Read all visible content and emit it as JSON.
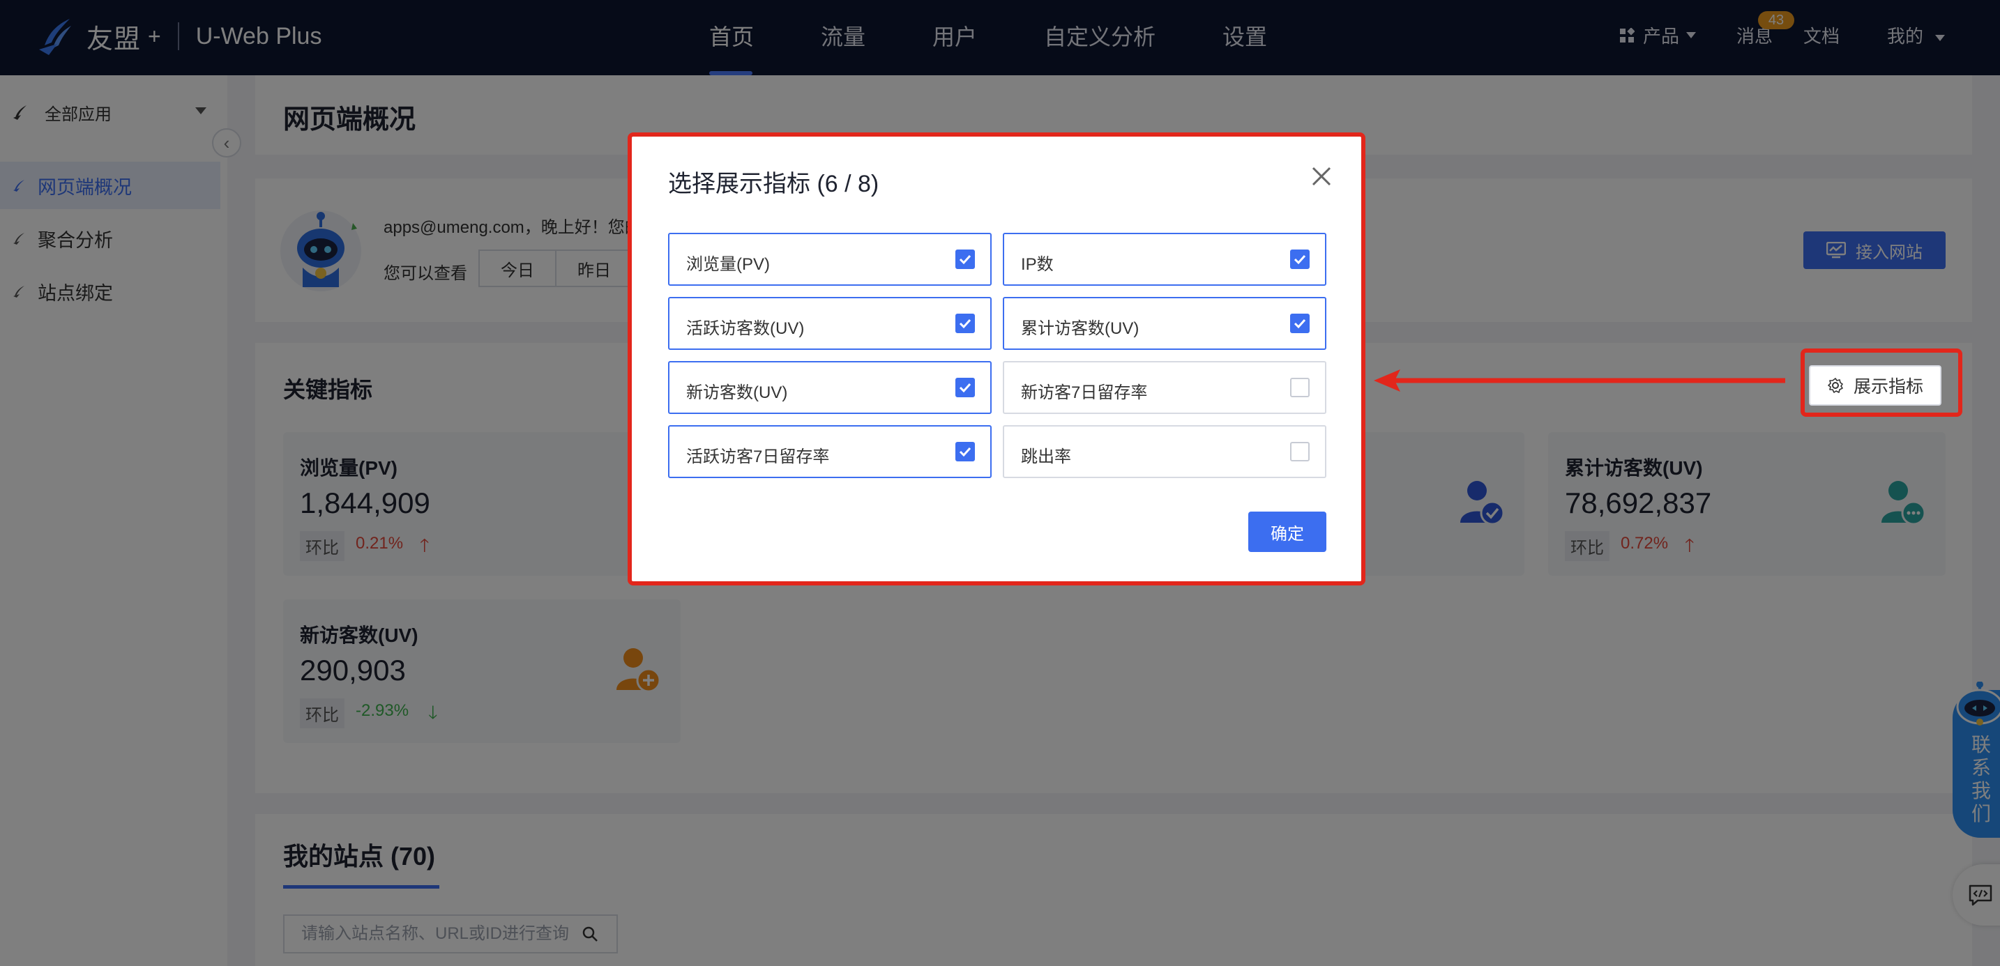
{
  "brand": {
    "name": "友盟",
    "plus": "+",
    "product": "U-Web Plus"
  },
  "nav": {
    "tabs": [
      "首页",
      "流量",
      "用户",
      "自定义分析",
      "设置"
    ],
    "active_tab": "首页",
    "products": "产品",
    "messages": "消息",
    "messages_badge": "43",
    "docs": "文档",
    "mine": "我的"
  },
  "sidebar": {
    "app_select": "全部应用",
    "items": [
      {
        "label": "网页端概况",
        "active": true
      },
      {
        "label": "聚合分析",
        "active": false
      },
      {
        "label": "站点绑定",
        "active": false
      }
    ]
  },
  "main": {
    "page_title": "网页端概况",
    "greeting": "apps@umeng.com，晚上好！您的",
    "view_prefix": "您可以查看",
    "date_buttons": [
      "今日",
      "昨日"
    ],
    "connect_button": "接入网站",
    "key_metrics_title": "关键指标",
    "show_metrics_button": "展示指标",
    "cards": [
      {
        "label": "浏览量(PV)",
        "value": "1,844,909",
        "compare_label": "环比",
        "change": "0.21%",
        "direction": "up",
        "icon": "pv-icon"
      },
      {
        "label": "累计访客数(UV)",
        "value": "78,692,837",
        "compare_label": "环比",
        "change": "0.72%",
        "direction": "up",
        "icon": "user-chat-icon"
      },
      {
        "label": "新访客数(UV)",
        "value": "290,903",
        "compare_label": "环比",
        "change": "-2.93%",
        "direction": "down",
        "icon": "user-add-icon"
      }
    ],
    "sites_title": "我的站点 (70)",
    "search_placeholder": "请输入站点名称、URL或ID进行查询"
  },
  "contact": {
    "label": "联系我们"
  },
  "modal": {
    "title": "选择展示指标 (6 / 8)",
    "options": [
      {
        "label": "浏览量(PV)",
        "checked": true
      },
      {
        "label": "IP数",
        "checked": true
      },
      {
        "label": "活跃访客数(UV)",
        "checked": true
      },
      {
        "label": "累计访客数(UV)",
        "checked": true
      },
      {
        "label": "新访客数(UV)",
        "checked": true
      },
      {
        "label": "新访客7日留存率",
        "checked": false
      },
      {
        "label": "活跃访客7日留存率",
        "checked": true
      },
      {
        "label": "跳出率",
        "checked": false
      }
    ],
    "confirm_button": "确定"
  },
  "colors": {
    "nav_bg": "#0d1631",
    "accent": "#3c6ef0",
    "highlight_red": "#e2261b",
    "up_red": "#e3493b",
    "down_green": "#3fb24e",
    "badge_orange": "#ec9a1e"
  }
}
